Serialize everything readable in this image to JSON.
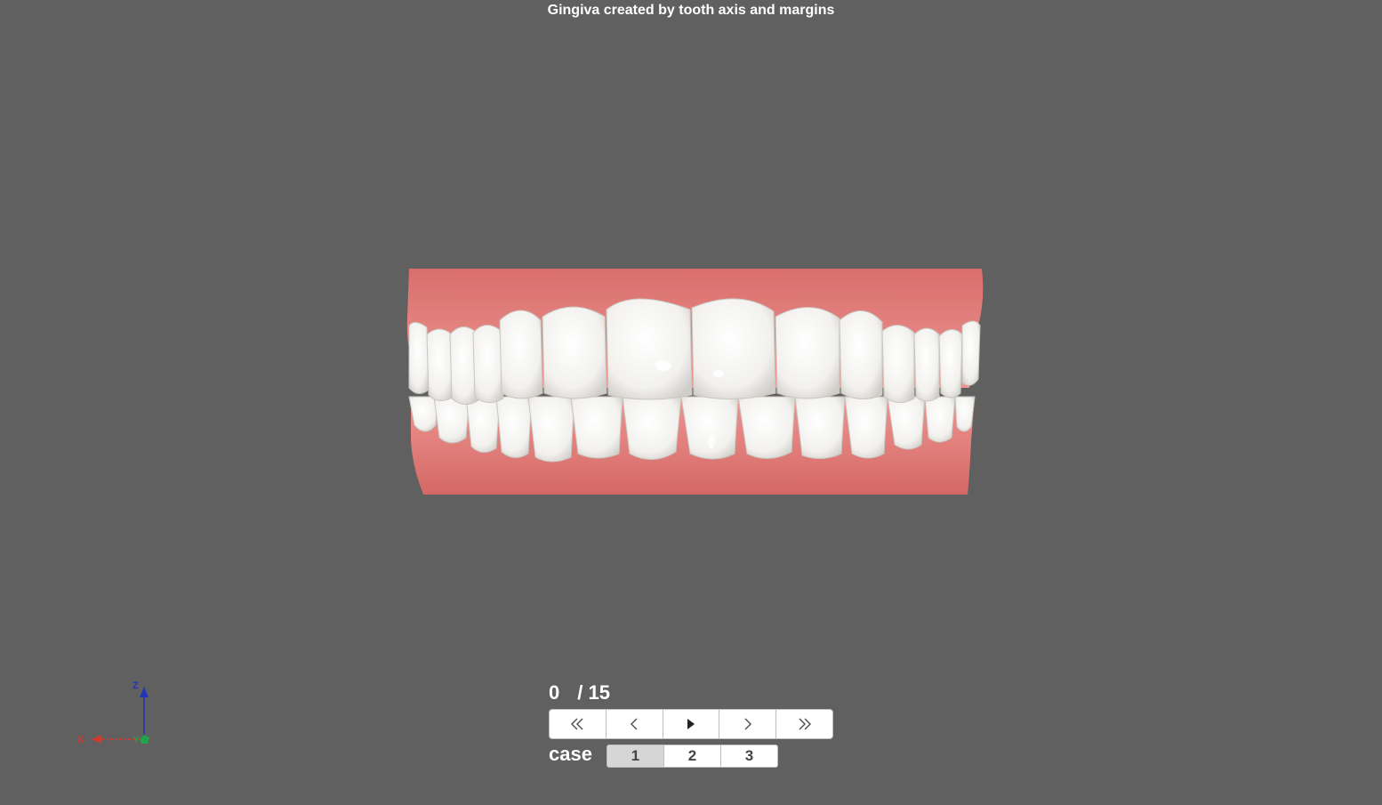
{
  "title": "Gingiva created by tooth axis and margins",
  "frame": {
    "current": "0",
    "total": "/ 15"
  },
  "playback": {
    "buttons": [
      {
        "name": "first-frame-button",
        "icon": "double-chevron-left-icon"
      },
      {
        "name": "previous-frame-button",
        "icon": "chevron-left-icon"
      },
      {
        "name": "play-button",
        "icon": "play-icon"
      },
      {
        "name": "next-frame-button",
        "icon": "chevron-right-icon"
      },
      {
        "name": "last-frame-button",
        "icon": "double-chevron-right-icon"
      }
    ]
  },
  "case": {
    "label": "case",
    "options": [
      "1",
      "2",
      "3"
    ],
    "selected": "1"
  },
  "axes": {
    "x_label": "X",
    "y_label": "Y",
    "z_label": "Z",
    "x_color": "#d8382c",
    "y_color": "#21a34a",
    "z_color": "#2234b8"
  },
  "colors": {
    "background": "#606060",
    "gingiva": "#e07f7c",
    "teeth": "#f4f4f2"
  }
}
